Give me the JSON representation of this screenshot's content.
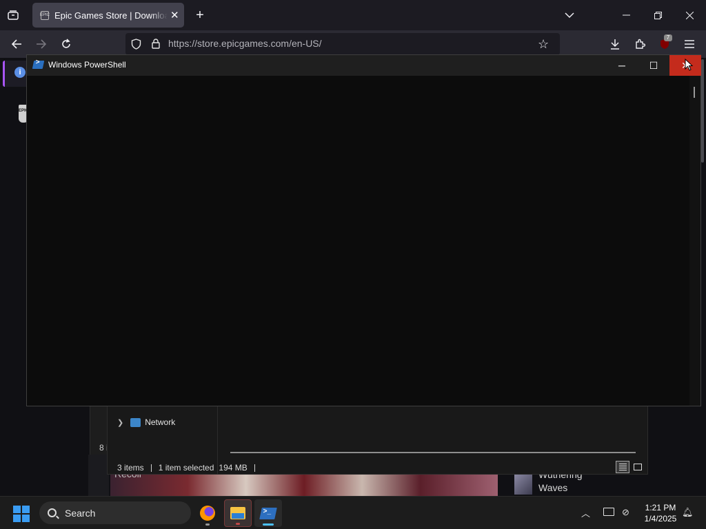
{
  "browser": {
    "active_tab_title": "Epic Games Store | Download & Play PC Games",
    "url": "https://store.epicgames.com/en-US/",
    "extension_badge": "7",
    "favicon_text": "EPIC"
  },
  "powershell": {
    "title": "Windows PowerShell",
    "minimize_glyph": "─",
    "maximize_glyph": "☐",
    "close_glyph": "✕"
  },
  "explorer": {
    "nav_item": "Network",
    "status_items": "3 items",
    "status_selected": "1 item selected",
    "status_size": "194 MB",
    "left_partial_number": "8 i"
  },
  "page_behind": {
    "game_left_title": "Recoil",
    "game_right_title": "Wuthering Waves"
  },
  "taskbar": {
    "search_placeholder": "Search",
    "time": "1:21 PM",
    "date": "1/4/2025"
  },
  "colors": {
    "close_hover": "#c42b1c",
    "start_blue": "#3a9cf2",
    "accent_purple": "#a855f7"
  }
}
